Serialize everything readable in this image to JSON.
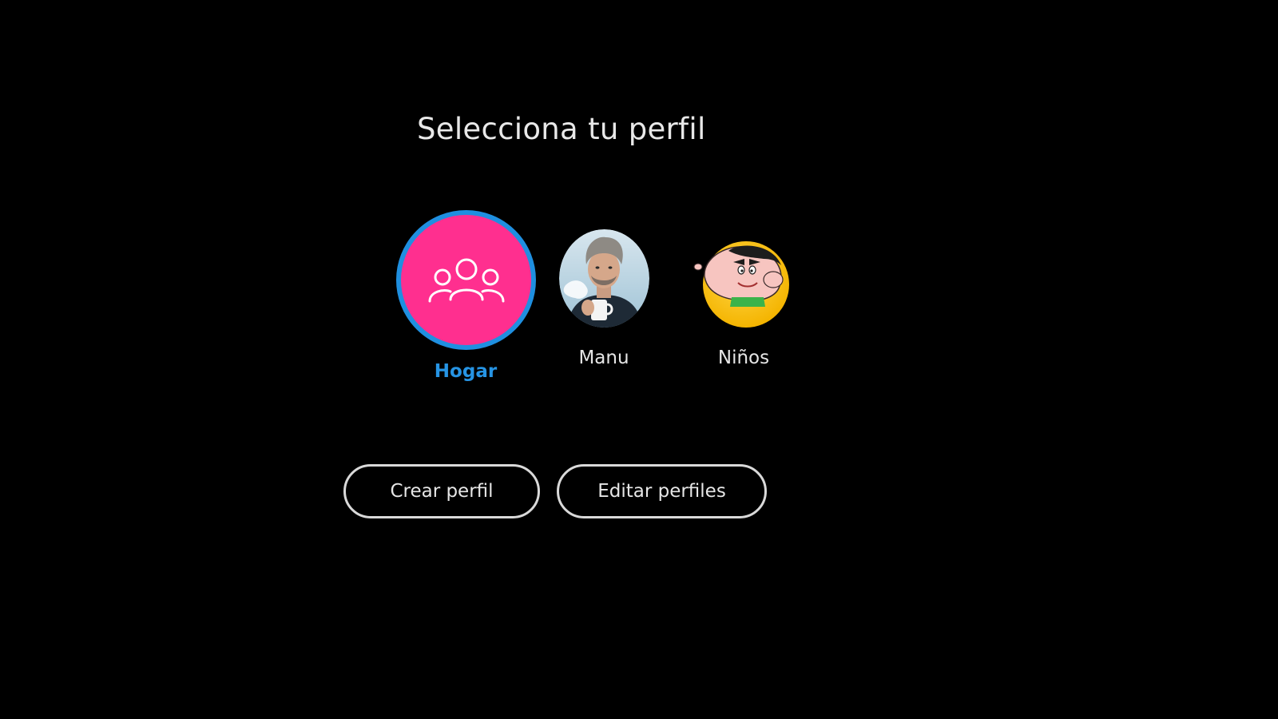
{
  "page": {
    "title": "Selecciona tu perfil"
  },
  "profiles": [
    {
      "id": "hogar",
      "name": "Hogar",
      "selected": true,
      "icon": "group-icon",
      "avatar_color": "#ff2f8f",
      "ring_color": "#1f8fe0",
      "label_color": "#2694e4"
    },
    {
      "id": "manu",
      "name": "Manu",
      "selected": false,
      "icon": "person-photo-avatar"
    },
    {
      "id": "ninos",
      "name": "Niños",
      "selected": false,
      "icon": "cartoon-character-avatar"
    }
  ],
  "actions": {
    "create_label": "Crear perfil",
    "edit_label": "Editar perfiles"
  },
  "colors": {
    "background": "#000000",
    "text": "#e8e8e8",
    "accent": "#1f8fe0",
    "hogar_pink": "#ff2f8f",
    "button_border": "#d9d9d9"
  }
}
